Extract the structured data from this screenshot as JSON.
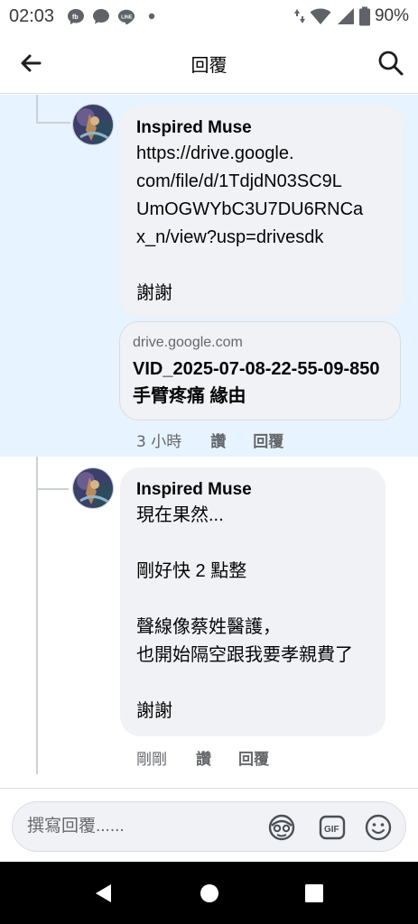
{
  "status_bar": {
    "time": "02:03",
    "battery_percent": "90%",
    "icons": [
      "messenger-icon",
      "chat-icon",
      "line-icon",
      "dot-icon",
      "data-arrows-icon",
      "wifi-icon",
      "signal-icon",
      "battery-icon"
    ]
  },
  "header": {
    "title": "回覆",
    "back_icon": "arrow-left-icon",
    "search_icon": "search-icon"
  },
  "comments": [
    {
      "author": "Inspired Muse",
      "text": "https://drive.google.\ncom/file/d/1TdjdN03SC9L\nUmOGWYbC3U7DU6RNCa\nx_n/view?usp=drivesdk\n\n謝謝",
      "link_preview": {
        "domain": "drive.google.com",
        "title": "VID_2025-07-08-22-55-09-850 手臂疼痛 緣由"
      },
      "time": "3 小時",
      "like_label": "讚",
      "reply_label": "回覆",
      "highlighted": true
    },
    {
      "author": "Inspired Muse",
      "text": "現在果然...\n\n剛好快 2 點整\n\n聲線像蔡姓醫護，\n也開始隔空跟我要孝親費了\n\n謝謝",
      "time": "剛剛",
      "like_label": "讚",
      "reply_label": "回覆",
      "highlighted": false
    }
  ],
  "composer": {
    "placeholder": "撰寫回覆......",
    "icons": [
      "avatar-sticker-icon",
      "gif-icon",
      "emoji-icon"
    ]
  },
  "nav_bar": {
    "icons": [
      "back-triangle-icon",
      "home-circle-icon",
      "recents-square-icon"
    ]
  },
  "colors": {
    "highlight_bg": "#e7f3ff",
    "bubble_bg": "#f0f2f5",
    "meta_text": "#65676b",
    "thread_line": "#ccd0d5"
  }
}
